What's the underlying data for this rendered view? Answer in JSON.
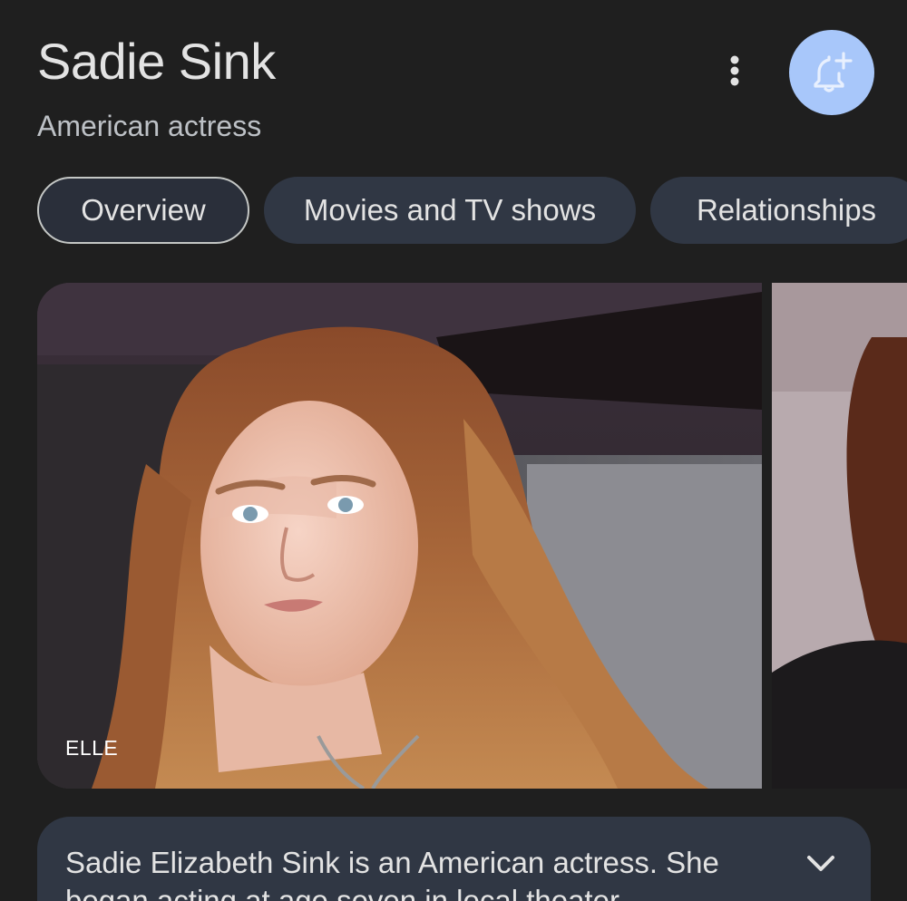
{
  "header": {
    "title": "Sadie Sink",
    "subtitle": "American actress",
    "more_icon": "more-vert-icon",
    "follow_icon": "bell-plus-icon",
    "follow_color": "#a8c7fa"
  },
  "tabs": [
    {
      "label": "Overview",
      "selected": true
    },
    {
      "label": "Movies and TV shows",
      "selected": false
    },
    {
      "label": "Relationships",
      "selected": false
    }
  ],
  "carousel": {
    "images": [
      {
        "source": "ELLE"
      },
      {
        "source": ""
      }
    ]
  },
  "description": {
    "text": "Sadie Elizabeth Sink is an American actress. She began acting at age seven in local theater",
    "expand_icon": "chevron-down-icon"
  },
  "colors": {
    "background": "#1f1f1f",
    "chip_background": "#303744",
    "text_primary": "#e3e3e3",
    "text_secondary": "#bdc1c6"
  }
}
